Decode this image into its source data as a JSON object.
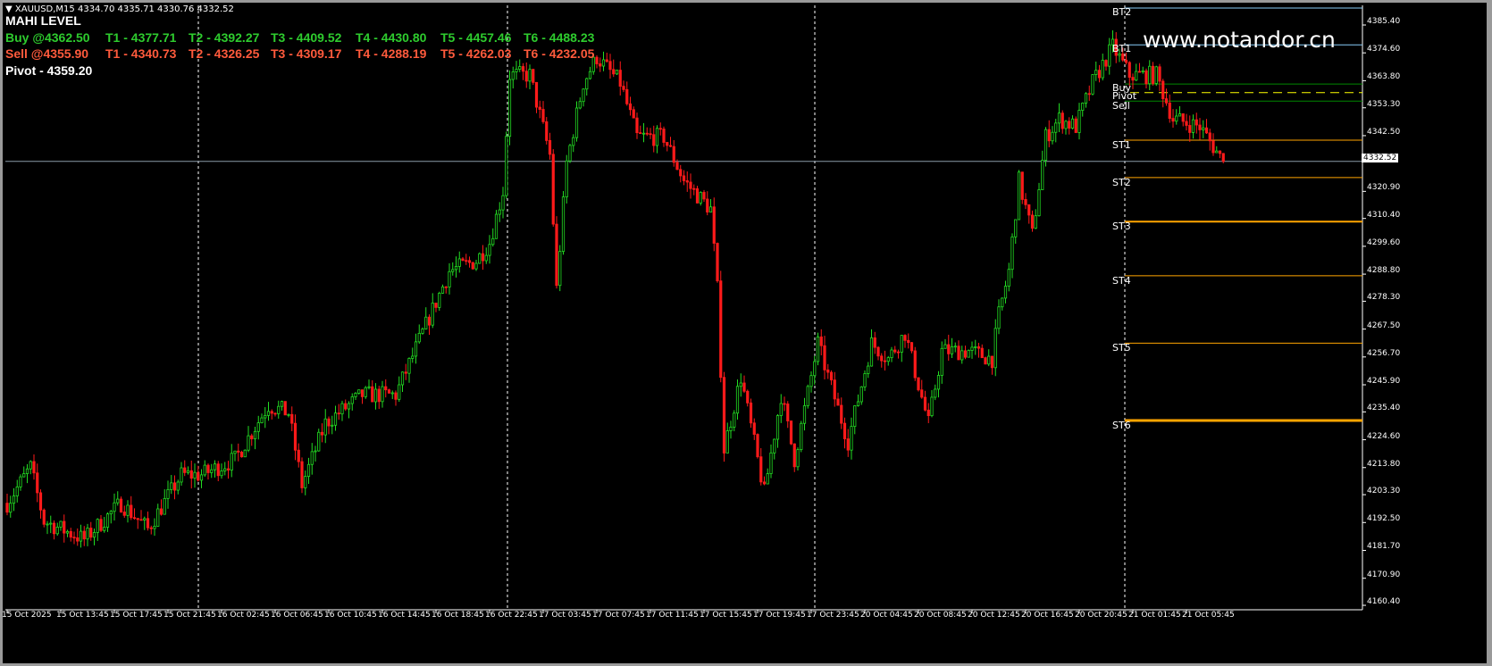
{
  "header": {
    "symbol_line": "XAUUSD,M15  4334.70 4335.71 4330.76 4332.52",
    "title": "MAHI LEVEL",
    "buy": [
      "Buy @4362.50",
      "T1 - 4377.71",
      "T2 - 4392.27",
      "T3 - 4409.52",
      "T4 - 4430.80",
      "T5 - 4457.46",
      "T6 - 4488.23"
    ],
    "sell": [
      "Sell @4355.90",
      "T1 - 4340.73",
      "T2 - 4326.25",
      "T3 - 4309.17",
      "T4 - 4288.19",
      "T5 - 4262.03",
      "T6 - 4232.05"
    ],
    "pivot": "Pivot - 4359.20"
  },
  "watermark": "www.notandor.cn",
  "colors": {
    "bull": "#22dd22",
    "bear": "#ff1a1a",
    "level_orange": "#ffa500",
    "level_green": "#008800",
    "pivot_yellow": "#ffff00",
    "bt_line": "#87cefa",
    "grid_sep": "#ffffff"
  },
  "chart_data": {
    "type": "candlestick",
    "symbol": "XAUUSD",
    "timeframe": "M15",
    "last_price": "4332.52",
    "ylim": [
      4160.4,
      4385.4
    ],
    "y_ticks": [
      "4385.40",
      "4374.60",
      "4363.80",
      "4353.30",
      "4342.50",
      "4320.90",
      "4310.40",
      "4299.60",
      "4288.80",
      "4278.30",
      "4267.50",
      "4256.70",
      "4245.90",
      "4235.40",
      "4224.60",
      "4213.80",
      "4203.30",
      "4192.50",
      "4181.70",
      "4170.90",
      "4160.40"
    ],
    "x_ticks": [
      "15 Oct 2025",
      "15 Oct 13:45",
      "15 Oct 17:45",
      "15 Oct 21:45",
      "16 Oct 02:45",
      "16 Oct 06:45",
      "16 Oct 10:45",
      "16 Oct 14:45",
      "16 Oct 18:45",
      "16 Oct 22:45",
      "17 Oct 03:45",
      "17 Oct 07:45",
      "17 Oct 11:45",
      "17 Oct 15:45",
      "17 Oct 19:45",
      "17 Oct 23:45",
      "20 Oct 04:45",
      "20 Oct 08:45",
      "20 Oct 12:45",
      "20 Oct 16:45",
      "20 Oct 20:45",
      "21 Oct 01:45",
      "21 Oct 05:45"
    ],
    "price_path": [
      [
        0,
        4200
      ],
      [
        7,
        4214
      ],
      [
        11,
        4193
      ],
      [
        23,
        4186
      ],
      [
        34,
        4200
      ],
      [
        42,
        4190
      ],
      [
        52,
        4211
      ],
      [
        58,
        4211
      ],
      [
        68,
        4217
      ],
      [
        78,
        4238
      ],
      [
        84,
        4235
      ],
      [
        88,
        4207
      ],
      [
        95,
        4231
      ],
      [
        106,
        4242
      ],
      [
        116,
        4242
      ],
      [
        124,
        4266
      ],
      [
        132,
        4290
      ],
      [
        140,
        4294
      ],
      [
        144,
        4301
      ],
      [
        148,
        4321
      ],
      [
        150,
        4366
      ],
      [
        156,
        4366
      ],
      [
        162,
        4335
      ],
      [
        164,
        4283
      ],
      [
        167,
        4332
      ],
      [
        172,
        4363
      ],
      [
        176,
        4373
      ],
      [
        183,
        4363
      ],
      [
        188,
        4342
      ],
      [
        196,
        4342
      ],
      [
        202,
        4325
      ],
      [
        210,
        4314
      ],
      [
        212,
        4283
      ],
      [
        214,
        4221
      ],
      [
        219,
        4249
      ],
      [
        226,
        4204
      ],
      [
        231,
        4242
      ],
      [
        235,
        4217
      ],
      [
        242,
        4262
      ],
      [
        246,
        4245
      ],
      [
        251,
        4224
      ],
      [
        258,
        4262
      ],
      [
        263,
        4256
      ],
      [
        268,
        4266
      ],
      [
        275,
        4231
      ],
      [
        279,
        4259
      ],
      [
        287,
        4259
      ],
      [
        294,
        4256
      ],
      [
        296,
        4273
      ],
      [
        299,
        4290
      ],
      [
        302,
        4325
      ],
      [
        306,
        4304
      ],
      [
        310,
        4342
      ],
      [
        314,
        4349
      ],
      [
        319,
        4346
      ],
      [
        324,
        4363
      ],
      [
        330,
        4377
      ],
      [
        335,
        4366
      ],
      [
        343,
        4366
      ],
      [
        348,
        4349
      ],
      [
        356,
        4346
      ],
      [
        363,
        4332.52
      ]
    ],
    "levels": [
      {
        "label": "BT2",
        "price": 4388.0,
        "color": "#87cefa",
        "width": 1
      },
      {
        "label": "BT1",
        "price": 4377.71,
        "color": "#87cefa",
        "width": 1
      },
      {
        "label": "Buy",
        "price": 4362.5,
        "color": "#008800",
        "width": 1
      },
      {
        "label": "Pivot",
        "price": 4359.2,
        "color": "#ffff00",
        "width": 1,
        "dashed": true
      },
      {
        "label": "Sell",
        "price": 4355.9,
        "color": "#008800",
        "width": 1
      },
      {
        "label": "ST1",
        "price": 4340.73,
        "color": "#ffa500",
        "width": 1
      },
      {
        "label": "ST2",
        "price": 4326.25,
        "color": "#ffa500",
        "width": 1
      },
      {
        "label": "ST3",
        "price": 4309.17,
        "color": "#ffa500",
        "width": 2
      },
      {
        "label": "ST4",
        "price": 4288.19,
        "color": "#ffa500",
        "width": 1
      },
      {
        "label": "ST5",
        "price": 4262.03,
        "color": "#ffa500",
        "width": 1
      },
      {
        "label": "ST6",
        "price": 4232.05,
        "color": "#ffa500",
        "width": 3
      }
    ]
  }
}
